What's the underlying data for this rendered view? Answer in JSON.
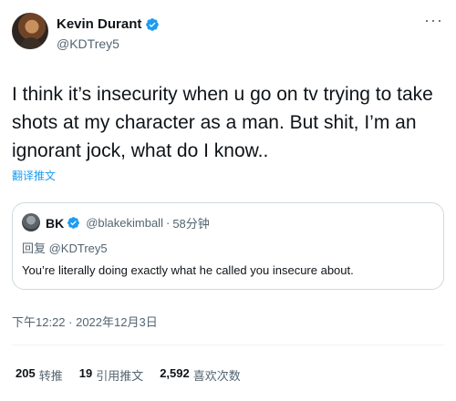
{
  "tweet": {
    "author": {
      "display_name": "Kevin Durant",
      "handle": "@KDTrey5",
      "verified": true
    },
    "more_icon": "more-horizontal-icon",
    "text": "I think it’s insecurity when u go on tv trying to take shots at my character as a man. But shit, I’m an ignorant jock, what do I know..",
    "translate_label": "翻译推文",
    "timestamp": "下午12:22 · 2022年12月3日"
  },
  "quote": {
    "display_name": "BK",
    "handle": "@blakekimball",
    "separator": "·",
    "time": "58分钟",
    "reply_to": "回复 @KDTrey5",
    "text": "You’re literally doing exactly what he called you insecure about."
  },
  "stats": [
    {
      "count": "205",
      "label": "转推"
    },
    {
      "count": "19",
      "label": "引用推文"
    },
    {
      "count": "2,592",
      "label": "喜欢次数"
    }
  ],
  "colors": {
    "accent": "#1d9bf0",
    "secondary_text": "#536471",
    "border": "#cfd9de"
  }
}
